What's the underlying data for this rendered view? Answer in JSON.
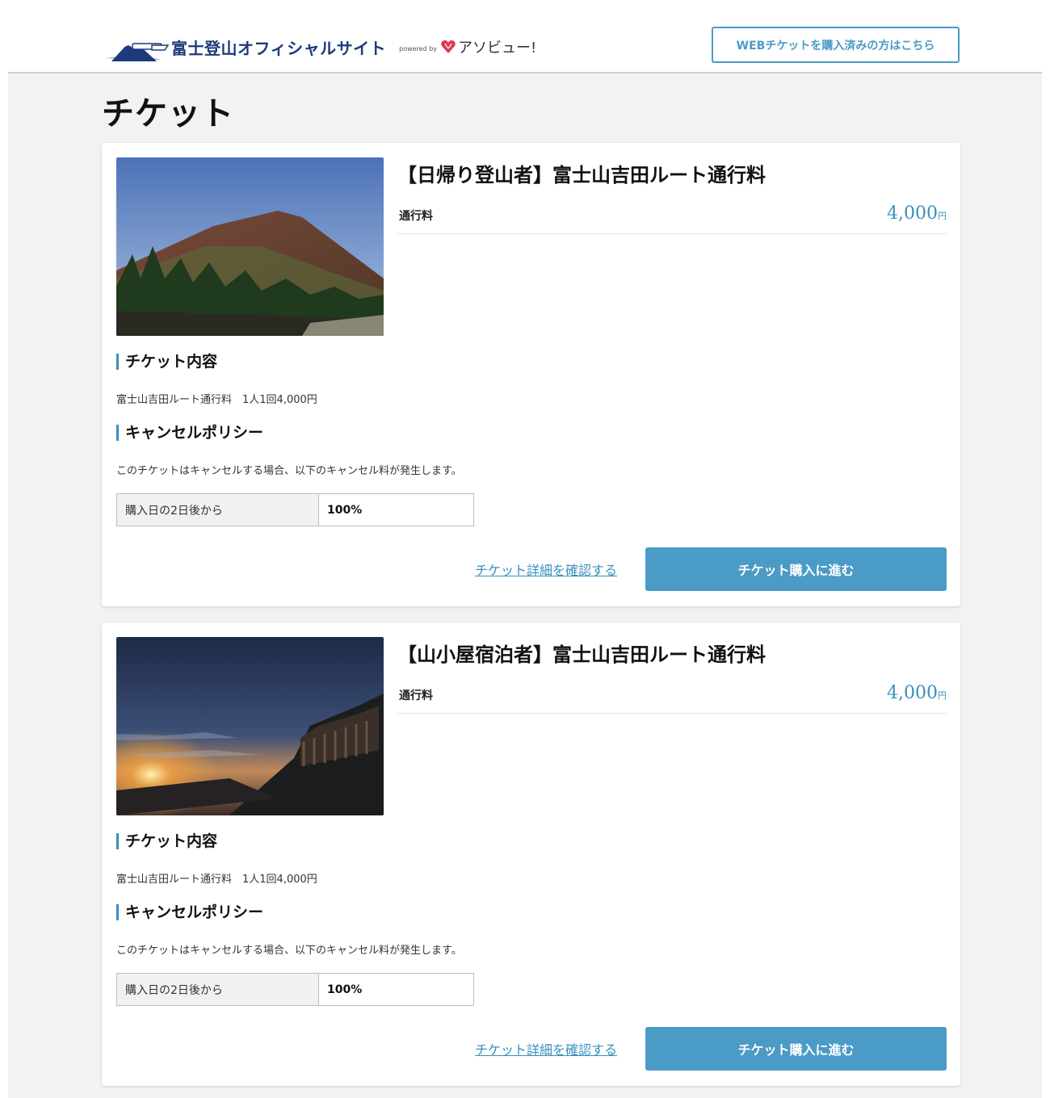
{
  "header": {
    "site_title": "富士登山オフィシャルサイト",
    "powered_by": "powered by",
    "partner_name": "アソビュー!",
    "purchased_button": "WEBチケットを購入済みの方はこちら"
  },
  "page": {
    "title": "チケット"
  },
  "tickets": [
    {
      "title": "【日帰り登山者】富士山吉田ルート通行料",
      "fee_label": "通行料",
      "price": "4,000",
      "currency": "円",
      "contents_heading": "チケット内容",
      "contents_text": "富士山吉田ルート通行料　1人1回4,000円",
      "cancel_heading": "キャンセルポリシー",
      "cancel_text": "このチケットはキャンセルする場合、以下のキャンセル料が発生します。",
      "cancel_row_label": "購入日の2日後から",
      "cancel_row_value": "100%",
      "detail_link": "チケット詳細を確認する",
      "buy_button": "チケット購入に進む"
    },
    {
      "title": "【山小屋宿泊者】富士山吉田ルート通行料",
      "fee_label": "通行料",
      "price": "4,000",
      "currency": "円",
      "contents_heading": "チケット内容",
      "contents_text": "富士山吉田ルート通行料　1人1回4,000円",
      "cancel_heading": "キャンセルポリシー",
      "cancel_text": "このチケットはキャンセルする場合、以下のキャンセル料が発生します。",
      "cancel_row_label": "購入日の2日後から",
      "cancel_row_value": "100%",
      "detail_link": "チケット詳細を確認する",
      "buy_button": "チケット購入に進む"
    }
  ],
  "colors": {
    "accent": "#4a9bc6",
    "price": "#3b8fbd",
    "brand": "#1d3a7a",
    "background": "#f2f2f2"
  }
}
